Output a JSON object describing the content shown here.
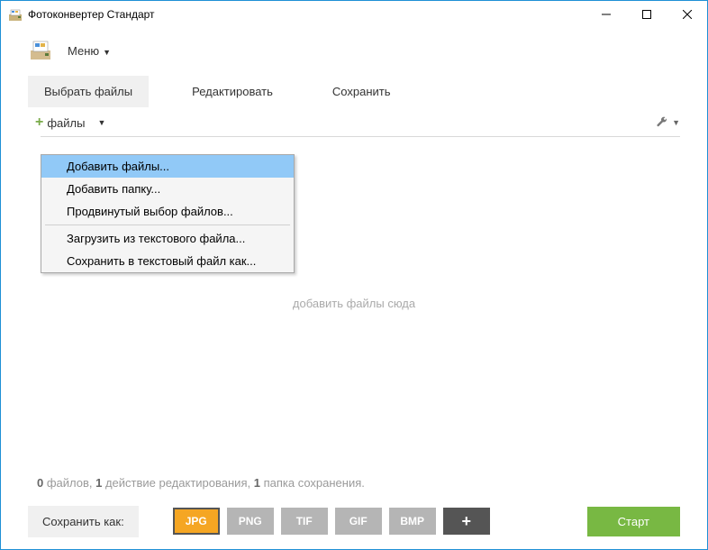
{
  "window": {
    "title": "Фотоконвертер Стандарт"
  },
  "menu": {
    "label": "Меню"
  },
  "tabs": {
    "select": "Выбрать файлы",
    "edit": "Редактировать",
    "save": "Сохранить"
  },
  "toolbar": {
    "files_label": "файлы"
  },
  "dropdown": {
    "add_files": "Добавить файлы...",
    "add_folder": "Добавить папку...",
    "advanced": "Продвинутый выбор файлов...",
    "load_txt": "Загрузить из текстового файла...",
    "save_txt": "Сохранить в текстовый файл как..."
  },
  "drop_hint": "добавить файлы сюда",
  "status": {
    "files_n": "0",
    "files_w": " файлов, ",
    "edit_n": "1",
    "edit_w": " действие редактирования, ",
    "folder_n": "1",
    "folder_w": " папка сохранения."
  },
  "bottom": {
    "save_as": "Сохранить как:",
    "formats": {
      "jpg": "JPG",
      "png": "PNG",
      "tif": "TIF",
      "gif": "GIF",
      "bmp": "BMP",
      "add": "+"
    },
    "start": "Старт"
  },
  "colors": {
    "accent": "#f5a623",
    "green": "#78b843",
    "highlight": "#91c9f7"
  }
}
